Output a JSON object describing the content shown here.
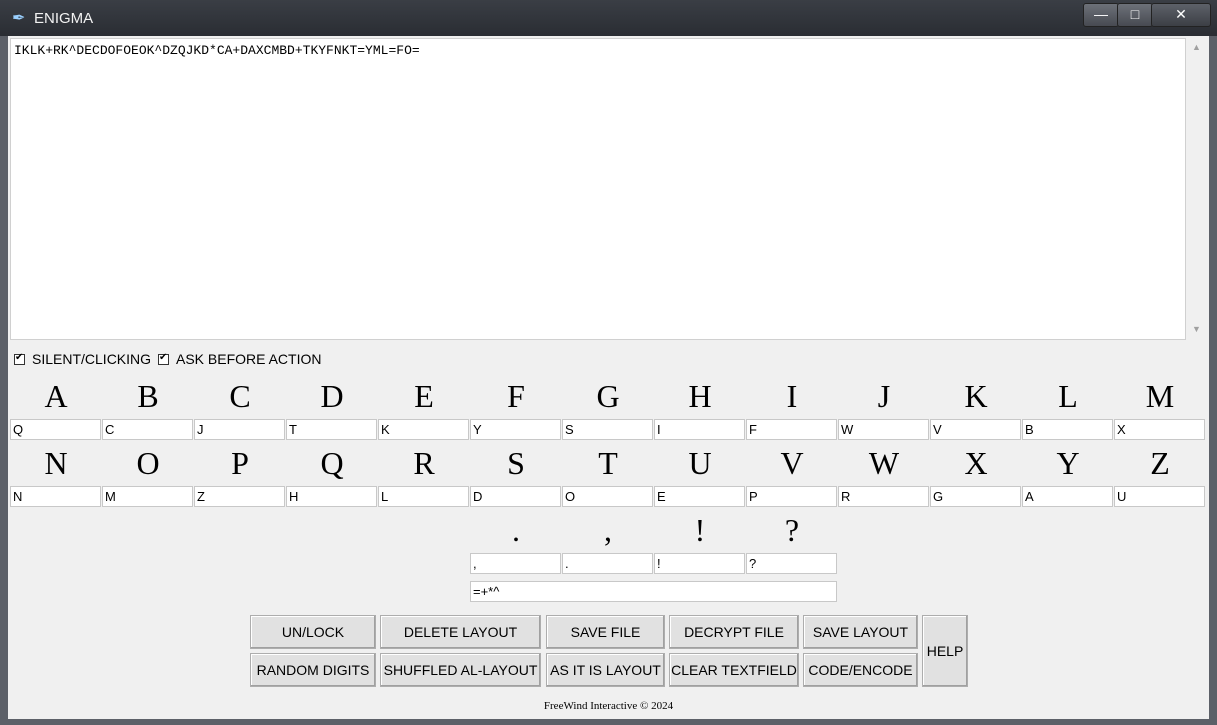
{
  "window": {
    "title": "ENIGMA"
  },
  "text_area": {
    "value": "IKLK+RK^DECDOFOEOK^DZQJKD*CA+DAXCMBD+TKYFNKT=YML=FO="
  },
  "options": [
    {
      "label": "SILENT/CLICKING",
      "checked": true
    },
    {
      "label": "ASK BEFORE ACTION",
      "checked": true
    }
  ],
  "rows": [
    {
      "letters": [
        "A",
        "B",
        "C",
        "D",
        "E",
        "F",
        "G",
        "H",
        "I",
        "J",
        "K",
        "L",
        "M"
      ],
      "mappings": [
        "Q",
        "C",
        "J",
        "T",
        "K",
        "Y",
        "S",
        "I",
        "F",
        "W",
        "V",
        "B",
        "X"
      ]
    },
    {
      "letters": [
        "N",
        "O",
        "P",
        "Q",
        "R",
        "S",
        "T",
        "U",
        "V",
        "W",
        "X",
        "Y",
        "Z"
      ],
      "mappings": [
        "N",
        "M",
        "Z",
        "H",
        "L",
        "D",
        "O",
        "E",
        "P",
        "R",
        "G",
        "A",
        "U"
      ]
    }
  ],
  "punctuation": {
    "labels": [
      ".",
      ",",
      "!",
      "?"
    ],
    "mappings": [
      ",",
      ".",
      "!",
      "?"
    ]
  },
  "extra_field": {
    "value": "=+*^"
  },
  "buttons": {
    "unlock": "UN/LOCK",
    "delete_layout": "DELETE LAYOUT",
    "save_file": "SAVE FILE",
    "decrypt_file": "DECRYPT FILE",
    "save_layout": "SAVE LAYOUT",
    "random_digits": "RANDOM DIGITS",
    "shuffled_layout": "SHUFFLED AL-LAYOUT",
    "as_it_is_layout": "AS IT IS LAYOUT",
    "clear_textfield": "CLEAR TEXTFIELD",
    "code_encode": "CODE/ENCODE",
    "help": "HELP"
  },
  "footer": "FreeWind Interactive © 2024"
}
